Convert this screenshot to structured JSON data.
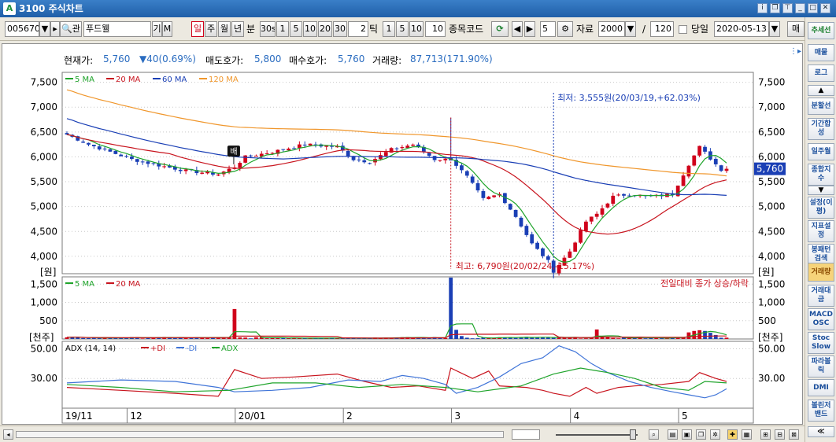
{
  "window": {
    "title": "3100 주식차트",
    "logo": "A"
  },
  "toolbar": {
    "code": "005670",
    "search_label": "🔍관",
    "name": "푸드웰",
    "btn_gi": "기",
    "btn_m": "M",
    "periods": [
      "일",
      "주",
      "월",
      "년"
    ],
    "selected_period": "일",
    "min_label": "분",
    "min_opts": [
      "30s",
      "1",
      "5",
      "10",
      "20",
      "30"
    ],
    "tick_value": "2",
    "tick_label": "틱",
    "tick_opts": [
      "1",
      "5",
      "10"
    ],
    "tick_count": "10",
    "code_label": "종목코드",
    "step_value": "5",
    "data_label": "자료",
    "data_count": "2000",
    "slash": "/",
    "view_count": "120",
    "today_label": "당일",
    "date": "2020-05-13",
    "more_label": "매"
  },
  "info": {
    "cur_label": "현재가:",
    "cur_value": "5,760",
    "change": "▼40(0.69%)",
    "ask_label": "매도호가:",
    "ask_value": "5,800",
    "bid_label": "매수호가:",
    "bid_value": "5,760",
    "vol_label": "거래량:",
    "vol_value": "87,713(171.90%)"
  },
  "chart_data": [
    {
      "type": "candlestick",
      "title": "",
      "ylabel": "[원]",
      "ylim": [
        3650,
        7700
      ],
      "yticks": [
        4000,
        4500,
        5000,
        5500,
        6000,
        6500,
        7000,
        7500
      ],
      "ytick_labels": [
        "4,000",
        "4,500",
        "5,000",
        "5,500",
        "6,000",
        "6,500",
        "7,000",
        "7,500"
      ],
      "legend": [
        {
          "name": "5 MA",
          "color": "#1fa42b"
        },
        {
          "name": "20 MA",
          "color": "#c8141e"
        },
        {
          "name": "60 MA",
          "color": "#1a3fb5"
        },
        {
          "name": "120 MA",
          "color": "#f0962b"
        }
      ],
      "last_price": "5,760",
      "last_value": 5760,
      "annotations": [
        {
          "text": "최저: 3,555원(20/03/19,+62.03%)",
          "index": 90
        },
        {
          "text": "최고: 6,790원(20/02/24,-15.17%)",
          "index": 71
        },
        {
          "text": "배",
          "index": 31
        }
      ],
      "anchors": [
        [
          0,
          6450
        ],
        [
          4,
          6250
        ],
        [
          8,
          6100
        ],
        [
          12,
          5950
        ],
        [
          16,
          5850
        ],
        [
          22,
          5720
        ],
        [
          28,
          5650
        ],
        [
          31,
          5800
        ],
        [
          33,
          6000
        ],
        [
          38,
          6100
        ],
        [
          44,
          6250
        ],
        [
          50,
          6200
        ],
        [
          53,
          5950
        ],
        [
          56,
          5900
        ],
        [
          60,
          6150
        ],
        [
          64,
          6250
        ],
        [
          68,
          5950
        ],
        [
          71,
          5950
        ],
        [
          74,
          5600
        ],
        [
          77,
          5150
        ],
        [
          80,
          5250
        ],
        [
          83,
          4800
        ],
        [
          86,
          4250
        ],
        [
          89,
          3900
        ],
        [
          90,
          3700
        ],
        [
          93,
          4100
        ],
        [
          96,
          4700
        ],
        [
          98,
          4850
        ],
        [
          101,
          5200
        ],
        [
          104,
          5250
        ],
        [
          108,
          5200
        ],
        [
          112,
          5250
        ],
        [
          115,
          5850
        ],
        [
          117,
          6200
        ],
        [
          120,
          5850
        ],
        [
          122,
          5640
        ]
      ]
    },
    {
      "type": "bar",
      "title": "",
      "ylabel": "[천주]",
      "ylim": [
        0,
        1700
      ],
      "yticks": [
        500,
        1000,
        1500
      ],
      "ytick_labels": [
        "500",
        "1,000",
        "1,500"
      ],
      "legend": [
        {
          "name": "5 MA",
          "color": "#1fa42b"
        },
        {
          "name": "20 MA",
          "color": "#c8141e"
        }
      ],
      "note": "전일대비 종가 상승/하락",
      "spikes": [
        [
          31,
          820
        ],
        [
          71,
          1680
        ],
        [
          72,
          250
        ],
        [
          73,
          80
        ],
        [
          85,
          60
        ],
        [
          98,
          260
        ],
        [
          115,
          180
        ],
        [
          116,
          220
        ],
        [
          117,
          240
        ],
        [
          118,
          220
        ],
        [
          119,
          170
        ],
        [
          120,
          110
        ]
      ]
    },
    {
      "type": "line",
      "title": "",
      "legend": [
        {
          "name": "ADX (14, 14)",
          "color": "#c8141e"
        },
        {
          "name": "+DI",
          "color": "#c8141e"
        },
        {
          "name": "-DI",
          "color": "#3f74d8"
        },
        {
          "name": "ADX",
          "color": "#1fa42b"
        }
      ],
      "ylim": [
        10,
        55
      ],
      "yticks": [
        30,
        50
      ],
      "ytick_labels": [
        "30.00",
        "50.00"
      ],
      "series": [
        {
          "name": "+DI",
          "color": "#c8141e",
          "points": [
            [
              0,
              24
            ],
            [
              10,
              22
            ],
            [
              20,
              20
            ],
            [
              28,
              18
            ],
            [
              31,
              36
            ],
            [
              36,
              30
            ],
            [
              42,
              31
            ],
            [
              50,
              33
            ],
            [
              55,
              28
            ],
            [
              60,
              24
            ],
            [
              65,
              25
            ],
            [
              70,
              22
            ],
            [
              71,
              37
            ],
            [
              75,
              30
            ],
            [
              78,
              35
            ],
            [
              80,
              25
            ],
            [
              85,
              24
            ],
            [
              88,
              22
            ],
            [
              90,
              20
            ],
            [
              93,
              18
            ],
            [
              96,
              24
            ],
            [
              98,
              20
            ],
            [
              102,
              24
            ],
            [
              105,
              25
            ],
            [
              110,
              26
            ],
            [
              115,
              28
            ],
            [
              117,
              34
            ],
            [
              120,
              30
            ],
            [
              122,
              28
            ]
          ]
        },
        {
          "name": "-DI",
          "color": "#3f74d8",
          "points": [
            [
              0,
              27
            ],
            [
              10,
              29
            ],
            [
              20,
              28
            ],
            [
              28,
              24
            ],
            [
              31,
              21
            ],
            [
              38,
              22
            ],
            [
              45,
              24
            ],
            [
              52,
              29
            ],
            [
              58,
              28
            ],
            [
              62,
              32
            ],
            [
              66,
              30
            ],
            [
              70,
              26
            ],
            [
              72,
              20
            ],
            [
              76,
              24
            ],
            [
              80,
              31
            ],
            [
              84,
              40
            ],
            [
              88,
              44
            ],
            [
              91,
              52
            ],
            [
              94,
              48
            ],
            [
              97,
              40
            ],
            [
              100,
              34
            ],
            [
              104,
              28
            ],
            [
              108,
              24
            ],
            [
              112,
              21
            ],
            [
              115,
              19
            ],
            [
              118,
              17
            ],
            [
              120,
              19
            ],
            [
              122,
              23
            ]
          ]
        },
        {
          "name": "ADX",
          "color": "#1fa42b",
          "points": [
            [
              0,
              26
            ],
            [
              10,
              24
            ],
            [
              20,
              21
            ],
            [
              30,
              22
            ],
            [
              38,
              27
            ],
            [
              46,
              27
            ],
            [
              54,
              24
            ],
            [
              62,
              26
            ],
            [
              70,
              24
            ],
            [
              76,
              21
            ],
            [
              84,
              25
            ],
            [
              90,
              33
            ],
            [
              95,
              37
            ],
            [
              100,
              34
            ],
            [
              105,
              30
            ],
            [
              110,
              24
            ],
            [
              115,
              22
            ],
            [
              118,
              28
            ],
            [
              122,
              27
            ]
          ]
        }
      ]
    },
    {
      "type": "axis",
      "labels": [
        {
          "text": "19/11",
          "index": 0
        },
        {
          "text": "12",
          "index": 12
        },
        {
          "text": "20/01",
          "index": 32
        },
        {
          "text": "2",
          "index": 52
        },
        {
          "text": "3",
          "index": 72
        },
        {
          "text": "4",
          "index": 94
        },
        {
          "text": "5",
          "index": 114
        }
      ]
    }
  ],
  "sidebar": {
    "items": [
      "추세선",
      "매물",
      "로그",
      "▲",
      "분할선",
      "기간합성",
      "일주월",
      "종합지수",
      "▼",
      "설정(이평)",
      "지표설정",
      "봉패턴검색",
      "거래량",
      "거래대금",
      "MACD OSC",
      "Stoc Slow",
      "파라볼릭",
      "DMI",
      "볼린저밴드",
      "≪"
    ]
  },
  "colors": {
    "up": "#d0021b",
    "down": "#1a3fb5",
    "grid": "#c8c8c8",
    "title": "#2a6cc0"
  }
}
